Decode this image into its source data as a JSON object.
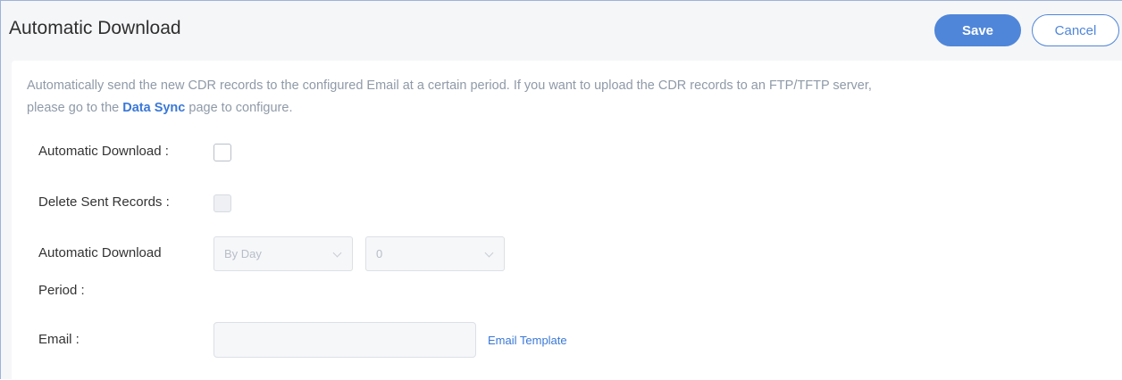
{
  "header": {
    "title": "Automatic Download",
    "save_label": "Save",
    "cancel_label": "Cancel"
  },
  "description": {
    "line1": "Automatically send the new CDR records to the configured Email at a certain period. If you want to upload the CDR records to an FTP/TFTP server,",
    "line2_prefix": "please go to the ",
    "link_text": "Data Sync",
    "line2_suffix": " page to configure."
  },
  "form": {
    "automatic_download_label": "Automatic Download :",
    "automatic_download_checked": false,
    "delete_sent_records_label": "Delete Sent Records :",
    "delete_sent_records_checked": false,
    "period_label_line1": "Automatic Download",
    "period_label_line2": "Period :",
    "period_unit_value": "By Day",
    "period_value": "0",
    "email_label": "Email :",
    "email_value": "",
    "email_template_link": "Email Template"
  }
}
